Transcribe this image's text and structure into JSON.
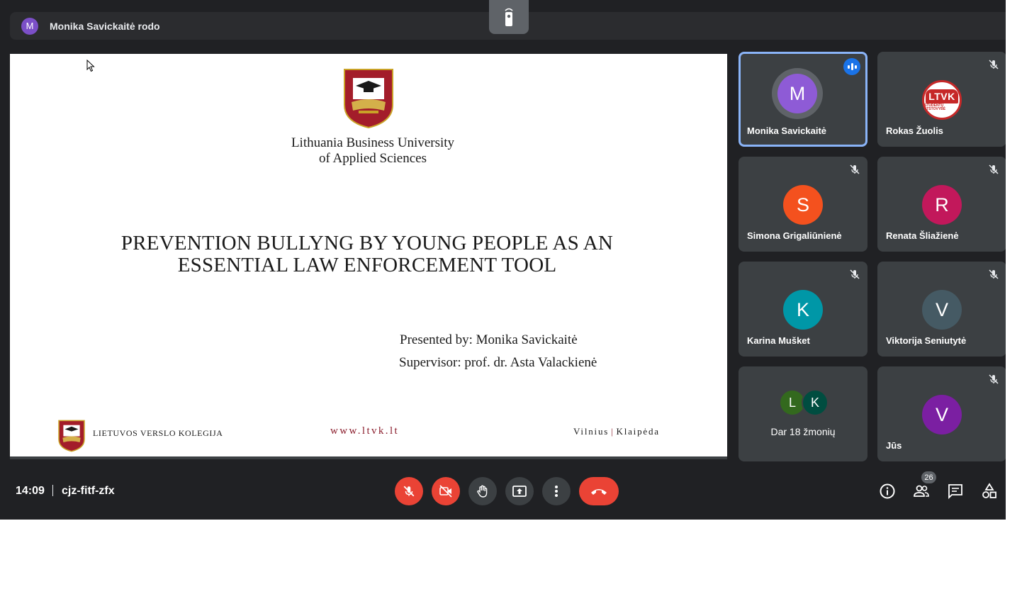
{
  "banner": {
    "avatar_letter": "M",
    "presenting_text": "Monika Savickaitė rodo"
  },
  "slide": {
    "university_line1": "Lithuania Business University",
    "university_line2": "of Applied Sciences",
    "title_line1": "PREVENTION BULLYNG BY YOUNG PEOPLE AS AN",
    "title_line2": "ESSENTIAL LAW ENFORCEMENT TOOL",
    "presented_by": "Presented by: Monika Savickaitė",
    "supervisor": "Supervisor: prof. dr. Asta Valackienė",
    "footer_name": "LIETUVOS VERSLO KOLEGIJA",
    "footer_url": "www.ltvk.lt",
    "footer_city1": "Vilnius",
    "footer_city2": "Klaipėda",
    "brand_color": "#8b1e2d"
  },
  "participants": [
    {
      "name": "Monika Savickaitė",
      "letter": "M",
      "color": "#8e5bd6",
      "speaking": true
    },
    {
      "name": "Rokas Žuolis",
      "letter": "",
      "logo_text": "LTVK",
      "logo_subtext": "STUDENTŲ ATSTOVYBĖ",
      "muted": true
    },
    {
      "name": "Simona Grigaliūnienė",
      "letter": "S",
      "color": "#f4511e",
      "muted": true
    },
    {
      "name": "Renata Šliažienė",
      "letter": "R",
      "color": "#c2185b",
      "muted": true
    },
    {
      "name": "Karina Mušket",
      "letter": "K",
      "color": "#0097a7",
      "muted": true
    },
    {
      "name": "Viktorija Seniutytė",
      "letter": "V",
      "color": "#455a64",
      "muted": true
    },
    {
      "name": "Jūs",
      "letter": "V",
      "color": "#7b1fa2",
      "muted": true
    }
  ],
  "more_people": {
    "avatars": [
      {
        "letter": "L",
        "color": "#33691e"
      },
      {
        "letter": "K",
        "color": "#004d40"
      }
    ],
    "label": "Dar 18 žmonių"
  },
  "bottom_bar": {
    "time": "14:09",
    "meeting_code": "cjz-fitf-zfx",
    "participant_count": "26"
  }
}
